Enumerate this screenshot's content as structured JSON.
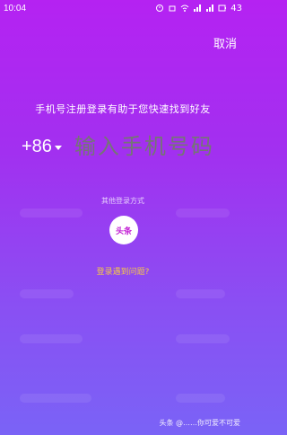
{
  "status": {
    "time": "10:04",
    "battery": "43"
  },
  "header": {
    "cancel_label": "取消"
  },
  "main": {
    "tip": "手机号注册登录有助于您快速找到好友",
    "country_code": "+86",
    "phone_placeholder": "输入手机号码",
    "other_login_label": "其他登录方式",
    "toutiao_label": "头条",
    "problem_link": "登录遇到问题?"
  },
  "watermark": {
    "text": "头条 @……你可爱不可爱"
  }
}
